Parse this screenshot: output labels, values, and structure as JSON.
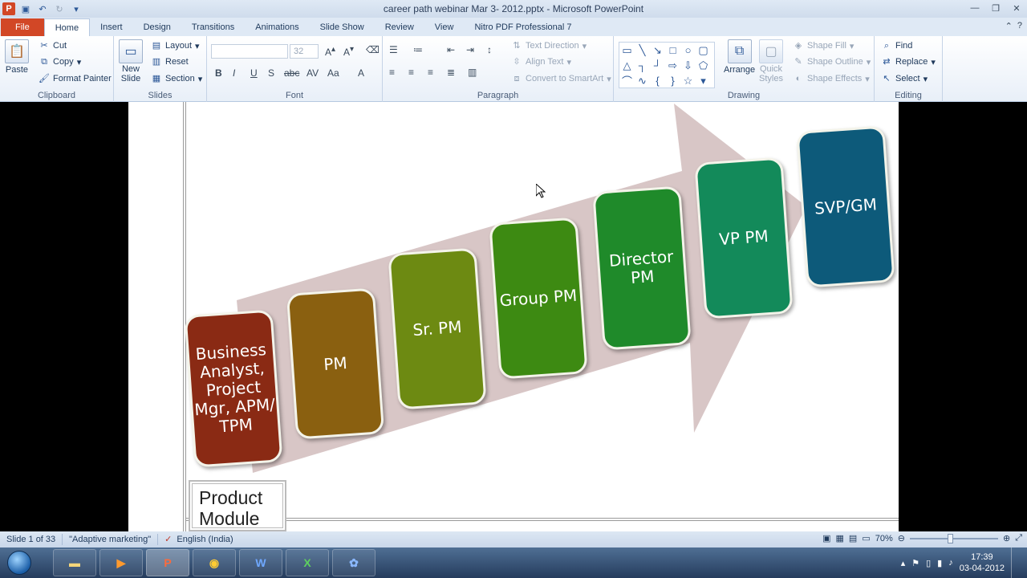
{
  "window": {
    "title": "career path webinar Mar 3- 2012.pptx  -  Microsoft PowerPoint",
    "app_icon_letter": "P"
  },
  "tabs": [
    {
      "label": "File"
    },
    {
      "label": "Home"
    },
    {
      "label": "Insert"
    },
    {
      "label": "Design"
    },
    {
      "label": "Transitions"
    },
    {
      "label": "Animations"
    },
    {
      "label": "Slide Show"
    },
    {
      "label": "Review"
    },
    {
      "label": "View"
    },
    {
      "label": "Nitro PDF Professional 7"
    }
  ],
  "ribbon": {
    "clipboard": {
      "label": "Clipboard",
      "paste": "Paste",
      "cut": "Cut",
      "copy": "Copy",
      "format_painter": "Format Painter"
    },
    "slides": {
      "label": "Slides",
      "new_slide_line1": "New",
      "new_slide_line2": "Slide",
      "layout": "Layout",
      "reset": "Reset",
      "section": "Section"
    },
    "font": {
      "label": "Font",
      "font_name": "",
      "font_size": "32"
    },
    "paragraph": {
      "label": "Paragraph",
      "text_direction": "Text Direction",
      "align_text": "Align Text",
      "convert_smartart": "Convert to SmartArt"
    },
    "drawing": {
      "label": "Drawing",
      "arrange": "Arrange",
      "quick_styles_line1": "Quick",
      "quick_styles_line2": "Styles",
      "shape_fill": "Shape Fill",
      "shape_outline": "Shape Outline",
      "shape_effects": "Shape Effects"
    },
    "editing": {
      "label": "Editing",
      "find": "Find",
      "replace": "Replace",
      "select": "Select"
    }
  },
  "slide": {
    "cards": [
      {
        "text": "Business Analyst, Project Mgr, APM/ TPM",
        "color": "#8a2a14"
      },
      {
        "text": "PM",
        "color": "#8a6010"
      },
      {
        "text": "Sr. PM",
        "color": "#6d8a12"
      },
      {
        "text": "Group PM",
        "color": "#3d8a12"
      },
      {
        "text": "Director PM",
        "color": "#1f8a2a"
      },
      {
        "text": "VP PM",
        "color": "#138a5a"
      },
      {
        "text": "SVP/GM",
        "color": "#0d5a7a"
      }
    ],
    "product_box_text": "Product Module",
    "arrow_color": "#d8c6c6"
  },
  "status": {
    "slide_info": "Slide 1 of 33",
    "theme": "\"Adaptive marketing\"",
    "language": "English (India)",
    "zoom": "70%"
  },
  "taskbar": {
    "time": "17:39",
    "date": "03-04-2012"
  }
}
